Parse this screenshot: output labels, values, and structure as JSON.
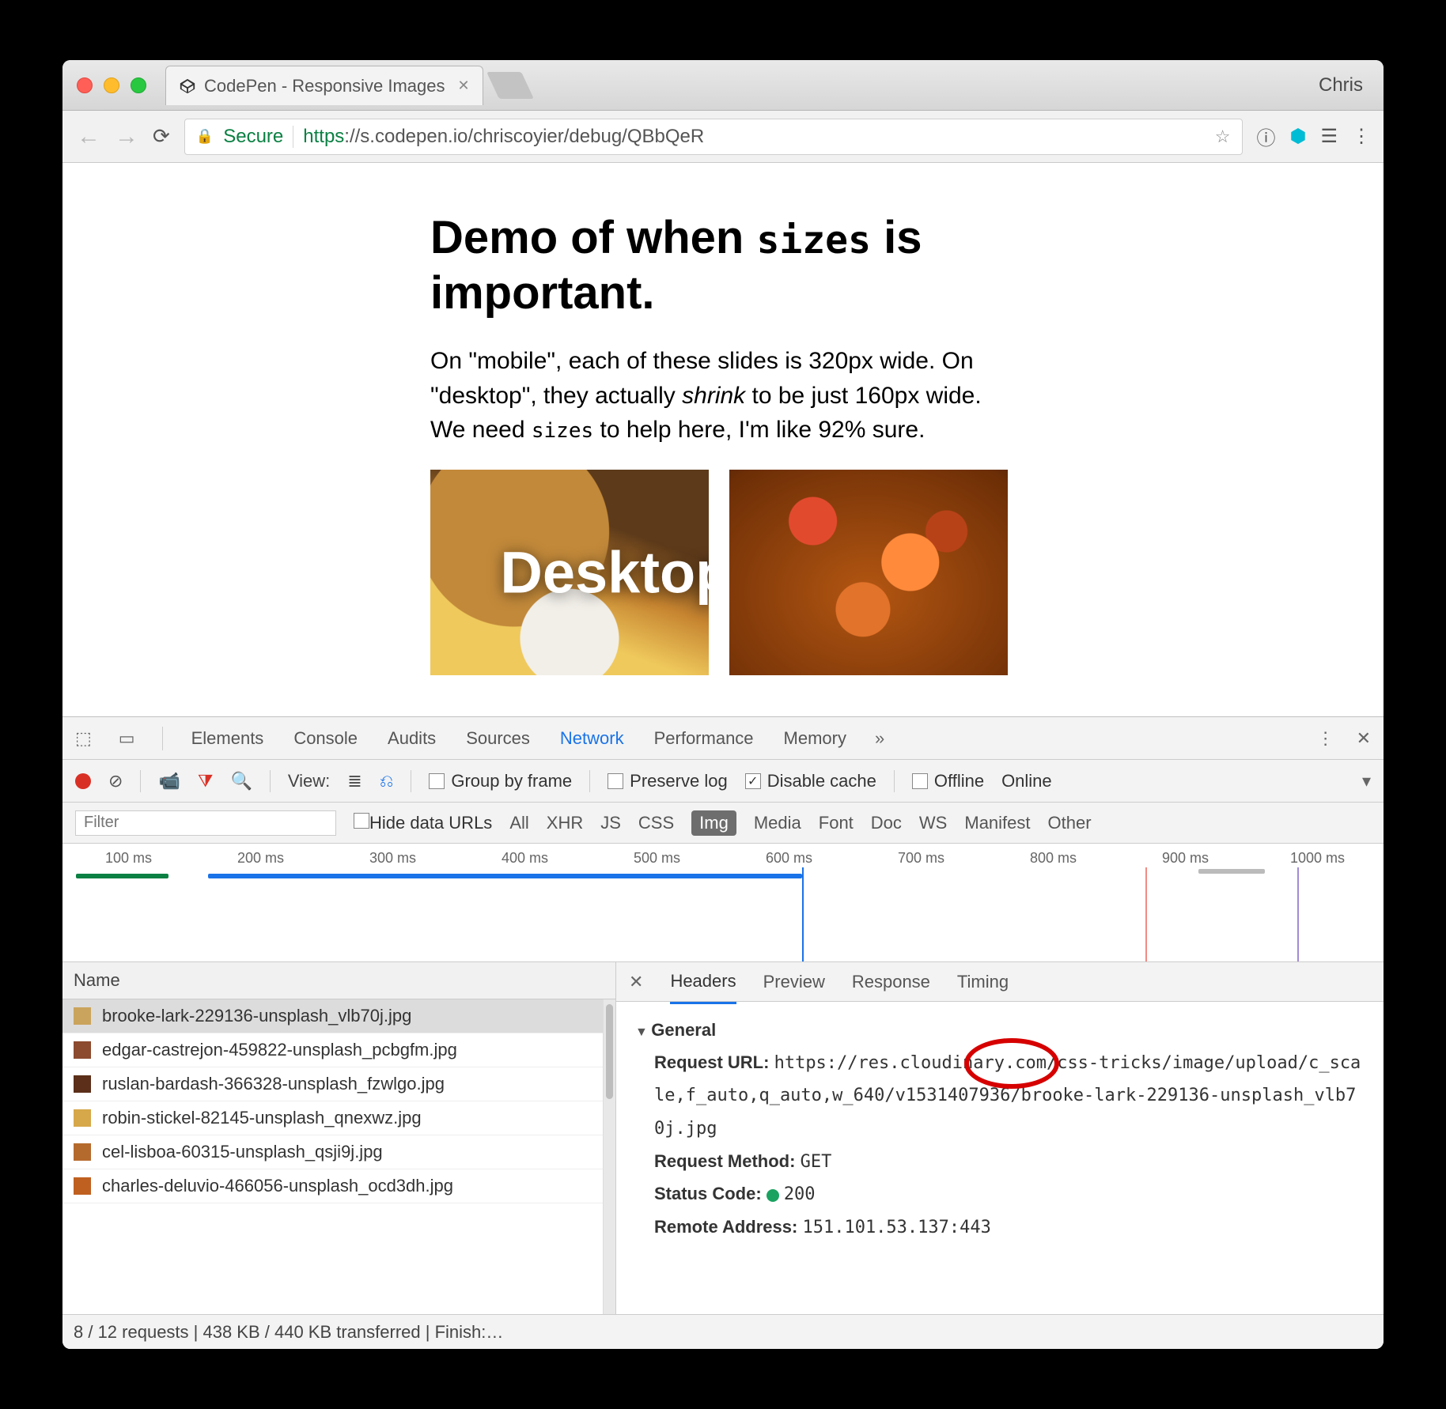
{
  "titlebar": {
    "tab_title": "CodePen - Responsive Images",
    "profile": "Chris"
  },
  "toolbar": {
    "secure_label": "Secure",
    "url_https": "https",
    "url_rest": "://s.codepen.io/chriscoyier/debug/QBbQeR"
  },
  "page": {
    "h1_a": "Demo of when ",
    "h1_code": "sizes",
    "h1_b": " is important.",
    "p_a": "On \"mobile\", each of these slides is 320px wide. On \"desktop\", they actually ",
    "p_em": "shrink",
    "p_b": " to be just 160px wide. We need ",
    "p_code": "sizes",
    "p_c": " to help here, I'm like 92% sure.",
    "slide_label": "Desktop"
  },
  "devtools": {
    "tabs": [
      "Elements",
      "Console",
      "Audits",
      "Sources",
      "Network",
      "Performance",
      "Memory"
    ],
    "active_tab": "Network",
    "view_label": "View:",
    "group_by_frame": "Group by frame",
    "preserve_log": "Preserve log",
    "disable_cache": "Disable cache",
    "offline": "Offline",
    "online": "Online",
    "filter_placeholder": "Filter",
    "hide_data_urls": "Hide data URLs",
    "types": [
      "All",
      "XHR",
      "JS",
      "CSS",
      "Img",
      "Media",
      "Font",
      "Doc",
      "WS",
      "Manifest",
      "Other"
    ],
    "active_type": "Img",
    "ticks": [
      "100 ms",
      "200 ms",
      "300 ms",
      "400 ms",
      "500 ms",
      "600 ms",
      "700 ms",
      "800 ms",
      "900 ms",
      "1000 ms"
    ],
    "name_header": "Name",
    "requests": [
      "brooke-lark-229136-unsplash_vlb70j.jpg",
      "edgar-castrejon-459822-unsplash_pcbgfm.jpg",
      "ruslan-bardash-366328-unsplash_fzwlgo.jpg",
      "robin-stickel-82145-unsplash_qnexwz.jpg",
      "cel-lisboa-60315-unsplash_qsji9j.jpg",
      "charles-deluvio-466056-unsplash_ocd3dh.jpg"
    ],
    "selected_request": 0,
    "details_tabs": [
      "Headers",
      "Preview",
      "Response",
      "Timing"
    ],
    "active_details_tab": "Headers",
    "general_label": "General",
    "req_url_label": "Request URL:",
    "req_url_value": "https://res.cloudinary.com/css-tricks/image/upload/c_scale,f_auto,q_auto,w_640/v1531407936/brooke-lark-229136-unsplash_vlb70j.jpg",
    "req_method_label": "Request Method:",
    "req_method_value": "GET",
    "status_code_label": "Status Code:",
    "status_code_value": "200",
    "remote_addr_label": "Remote Address:",
    "remote_addr_value": "151.101.53.137:443",
    "statusbar": "8 / 12 requests | 438 KB / 440 KB transferred | Finish:…"
  }
}
